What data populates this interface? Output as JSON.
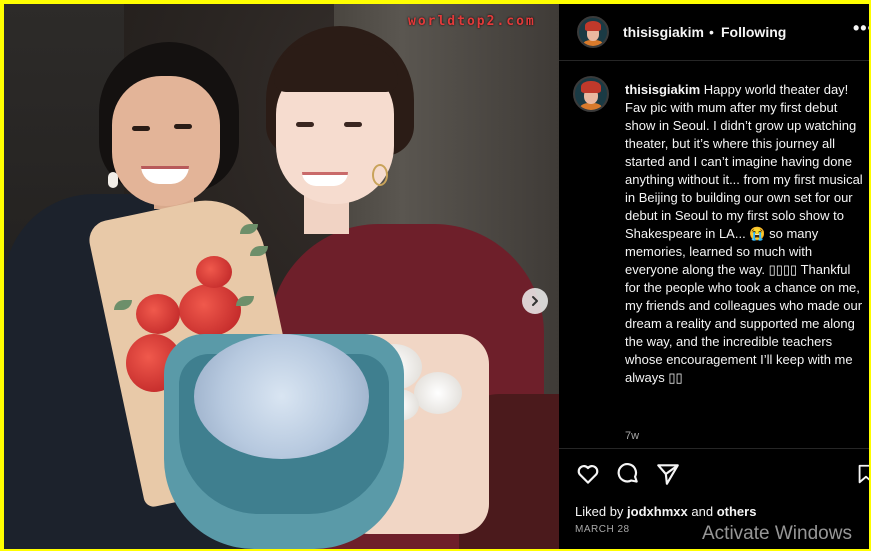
{
  "watermark": "worldtop2.com",
  "header": {
    "username": "thisisgiakim",
    "separator": "•",
    "follow_status": "Following",
    "more_label": "•••"
  },
  "post": {
    "username": "thisisgiakim",
    "caption": "Happy world theater day! Fav pic with mum after my first debut show in Seoul. I didn’t grow up watching theater, but it’s where this journey all started and I can’t imagine having done anything without it... from my first musical in Beijing to building our own set for our debut in Seoul to my first solo show to Shakespeare in LA... 😭 so many memories, learned so much with everyone along the way. ▯▯▯▯ Thankful for the people who took a chance on me, my friends and colleagues who made our dream a reality and supported me along the way, and the incredible teachers whose encouragement I’ll keep with me always ▯▯",
    "time_ago": "7w"
  },
  "likes": {
    "prefix": "Liked by",
    "user": "jodxhmxx",
    "connector": "and",
    "others": "others"
  },
  "date": "MARCH 28",
  "os_overlay": "Activate Windows",
  "icons": {
    "like": "heart-icon",
    "comment": "comment-bubble-icon",
    "share": "send-paper-plane-icon",
    "save": "bookmark-icon",
    "next": "chevron-right-icon",
    "more": "more-dots-icon"
  },
  "colors": {
    "page_border": "#ffff00",
    "panel_bg": "#000000",
    "text": "#f5f5f5",
    "muted": "#a8a8a8",
    "watermark": "#e23a3a"
  }
}
